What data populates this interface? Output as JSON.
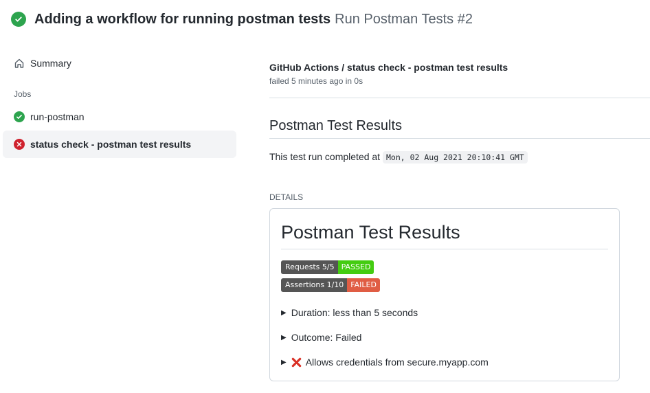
{
  "header": {
    "title": "Adding a workflow for running postman tests",
    "run_name": "Run Postman Tests #2"
  },
  "sidebar": {
    "summary_label": "Summary",
    "jobs_label": "Jobs",
    "jobs": [
      {
        "label": "run-postman",
        "status": "success"
      },
      {
        "label": "status check - postman test results",
        "status": "failure"
      }
    ]
  },
  "check": {
    "title": "GitHub Actions / status check - postman test results",
    "subtitle": "failed 5 minutes ago in 0s"
  },
  "results": {
    "heading": "Postman Test Results",
    "completed_prefix": "This test run completed at",
    "completed_time": "Mon, 02 Aug 2021 20:10:41 GMT",
    "details_label": "DETAILS",
    "details_heading": "Postman Test Results",
    "badges": [
      {
        "label": "Requests 5/5",
        "value": "PASSED",
        "color": "#44cc11"
      },
      {
        "label": "Assertions 1/10",
        "value": "FAILED",
        "color": "#e05d44"
      }
    ],
    "rows": [
      {
        "label": "Duration: less than 5 seconds"
      },
      {
        "label": "Outcome: Failed"
      },
      {
        "label": "Allows credentials from secure.myapp.com",
        "icon": "cross-mark-icon"
      }
    ]
  },
  "colors": {
    "success": "#2da44e",
    "failure": "#cf222e"
  }
}
